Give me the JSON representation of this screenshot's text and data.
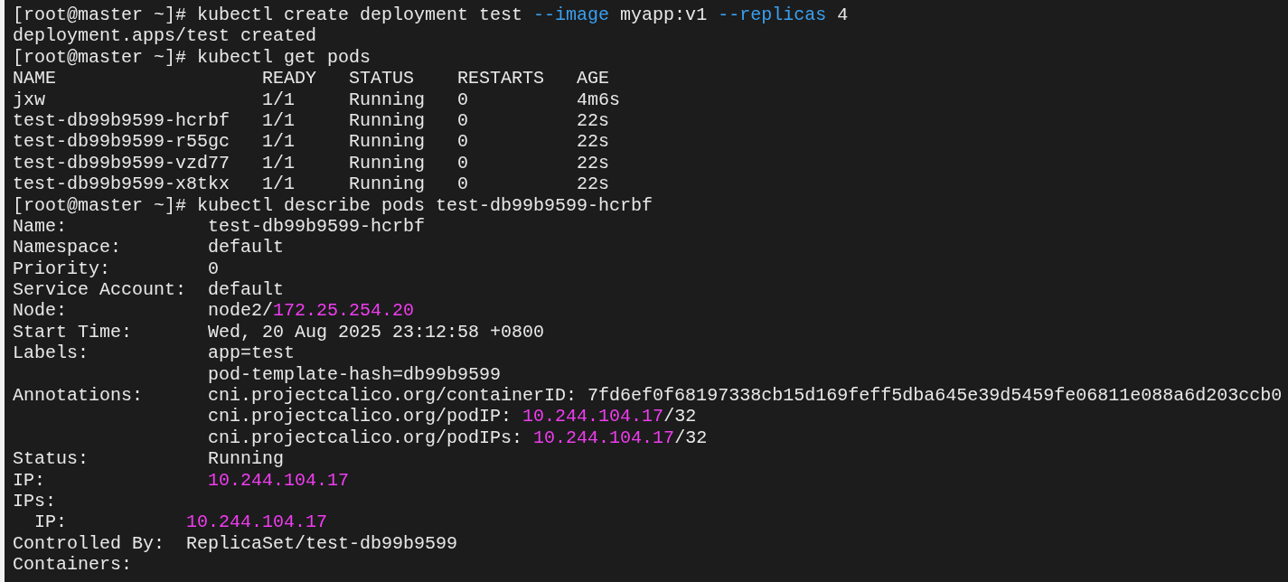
{
  "terminal": {
    "lines": [
      {
        "segments": [
          {
            "kind": "prompt",
            "text": "[root@master ~]# kubectl create deployment test "
          },
          {
            "kind": "flag",
            "text": "--image"
          },
          {
            "kind": "plain",
            "text": " myapp:v1 "
          },
          {
            "kind": "flag",
            "text": "--replicas"
          },
          {
            "kind": "plain",
            "text": " 4"
          }
        ]
      },
      {
        "segments": [
          {
            "kind": "plain",
            "text": "deployment.apps/test created"
          }
        ]
      },
      {
        "segments": [
          {
            "kind": "prompt",
            "text": "[root@master ~]# kubectl get pods"
          }
        ]
      },
      {
        "segments": [
          {
            "kind": "plain",
            "text": "NAME                   READY   STATUS    RESTARTS   AGE"
          }
        ]
      },
      {
        "segments": [
          {
            "kind": "plain",
            "text": "jxw                    1/1     Running   0          4m6s"
          }
        ]
      },
      {
        "segments": [
          {
            "kind": "plain",
            "text": "test-db99b9599-hcrbf   1/1     Running   0          22s"
          }
        ]
      },
      {
        "segments": [
          {
            "kind": "plain",
            "text": "test-db99b9599-r55gc   1/1     Running   0          22s"
          }
        ]
      },
      {
        "segments": [
          {
            "kind": "plain",
            "text": "test-db99b9599-vzd77   1/1     Running   0          22s"
          }
        ]
      },
      {
        "segments": [
          {
            "kind": "plain",
            "text": "test-db99b9599-x8tkx   1/1     Running   0          22s"
          }
        ]
      },
      {
        "segments": [
          {
            "kind": "prompt",
            "text": "[root@master ~]# kubectl describe pods test-db99b9599-hcrbf"
          }
        ]
      },
      {
        "segments": [
          {
            "kind": "plain",
            "text": "Name:             test-db99b9599-hcrbf"
          }
        ]
      },
      {
        "segments": [
          {
            "kind": "plain",
            "text": "Namespace:        default"
          }
        ]
      },
      {
        "segments": [
          {
            "kind": "plain",
            "text": "Priority:         0"
          }
        ]
      },
      {
        "segments": [
          {
            "kind": "plain",
            "text": "Service Account:  default"
          }
        ]
      },
      {
        "segments": [
          {
            "kind": "plain",
            "text": "Node:             node2/"
          },
          {
            "kind": "ip",
            "text": "172.25.254.20"
          }
        ]
      },
      {
        "segments": [
          {
            "kind": "plain",
            "text": "Start Time:       Wed, 20 Aug 2025 23:12:58 +0800"
          }
        ]
      },
      {
        "segments": [
          {
            "kind": "plain",
            "text": "Labels:           app=test"
          }
        ]
      },
      {
        "segments": [
          {
            "kind": "plain",
            "text": "                  pod-template-hash=db99b9599"
          }
        ]
      },
      {
        "segments": [
          {
            "kind": "plain",
            "text": "Annotations:      cni.projectcalico.org/containerID: 7fd6ef0f68197338cb15d169feff5dba645e39d5459fe06811e088a6d203ccb0"
          }
        ]
      },
      {
        "segments": [
          {
            "kind": "plain",
            "text": "                  cni.projectcalico.org/podIP: "
          },
          {
            "kind": "ip",
            "text": "10.244.104.17"
          },
          {
            "kind": "plain",
            "text": "/32"
          }
        ]
      },
      {
        "segments": [
          {
            "kind": "plain",
            "text": "                  cni.projectcalico.org/podIPs: "
          },
          {
            "kind": "ip",
            "text": "10.244.104.17"
          },
          {
            "kind": "plain",
            "text": "/32"
          }
        ]
      },
      {
        "segments": [
          {
            "kind": "plain",
            "text": "Status:           Running"
          }
        ]
      },
      {
        "segments": [
          {
            "kind": "plain",
            "text": "IP:               "
          },
          {
            "kind": "ip",
            "text": "10.244.104.17"
          }
        ]
      },
      {
        "segments": [
          {
            "kind": "plain",
            "text": "IPs:"
          }
        ]
      },
      {
        "segments": [
          {
            "kind": "plain",
            "text": "  IP:           "
          },
          {
            "kind": "ip",
            "text": "10.244.104.17"
          }
        ]
      },
      {
        "segments": [
          {
            "kind": "plain",
            "text": "Controlled By:  ReplicaSet/test-db99b9599"
          }
        ]
      },
      {
        "segments": [
          {
            "kind": "plain",
            "text": "Containers:"
          }
        ]
      }
    ]
  }
}
